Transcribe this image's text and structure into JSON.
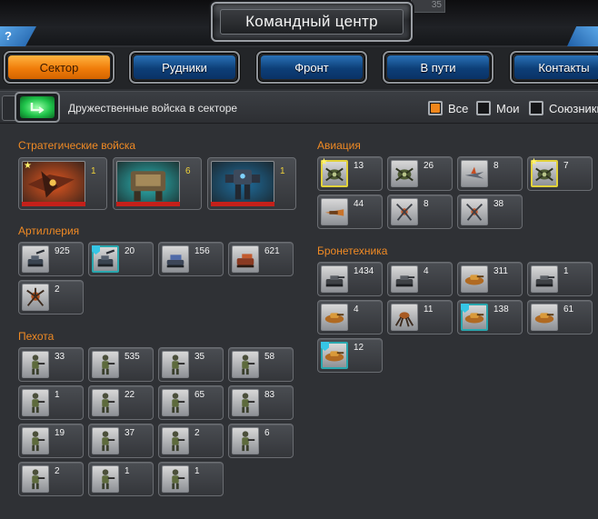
{
  "header": {
    "title": "Командный центр",
    "counter_fragment": "35",
    "help_label": "?"
  },
  "tabs": [
    {
      "label": "Сектор",
      "active": true
    },
    {
      "label": "Рудники",
      "active": false
    },
    {
      "label": "Фронт",
      "active": false
    },
    {
      "label": "В пути",
      "active": false
    },
    {
      "label": "Контакты",
      "active": false
    }
  ],
  "filter": {
    "label": "Дружественные войска в секторе",
    "options": [
      {
        "label": "Все",
        "checked": true
      },
      {
        "label": "Мои",
        "checked": false
      },
      {
        "label": "Союзники",
        "checked": false
      }
    ]
  },
  "sections": {
    "strategic": {
      "title": "Стратегические войска",
      "units": [
        {
          "count": "1",
          "icon": "strategic-bomber-icon",
          "bg": "#e2561f",
          "starred": true
        },
        {
          "count": "6",
          "icon": "armored-walker-icon",
          "bg": "#2bb8b8",
          "starred": false
        },
        {
          "count": "1",
          "icon": "heavy-mech-icon",
          "bg": "#1f6fa0",
          "starred": false
        }
      ]
    },
    "artillery": {
      "title": "Артиллерия",
      "units": [
        {
          "count": "925",
          "icon": "artillery-tank-icon",
          "frame": "normal"
        },
        {
          "count": "20",
          "icon": "artillery-tank-icon",
          "frame": "teal"
        },
        {
          "count": "156",
          "icon": "rocket-launcher-icon",
          "frame": "normal"
        },
        {
          "count": "621",
          "icon": "heavy-artillery-icon",
          "frame": "normal"
        },
        {
          "count": "2",
          "icon": "spider-artillery-icon",
          "frame": "normal"
        }
      ]
    },
    "infantry": {
      "title": "Пехота",
      "units": [
        {
          "count": "33",
          "icon": "soldier-icon",
          "frame": "normal"
        },
        {
          "count": "535",
          "icon": "soldier-icon",
          "frame": "normal"
        },
        {
          "count": "35",
          "icon": "soldier-icon",
          "frame": "normal"
        },
        {
          "count": "58",
          "icon": "soldier-icon",
          "frame": "normal"
        },
        {
          "count": "1",
          "icon": "soldier-icon",
          "frame": "normal"
        },
        {
          "count": "22",
          "icon": "soldier-icon",
          "frame": "normal"
        },
        {
          "count": "65",
          "icon": "soldier-icon",
          "frame": "normal"
        },
        {
          "count": "83",
          "icon": "soldier-icon",
          "frame": "normal"
        },
        {
          "count": "19",
          "icon": "soldier-icon",
          "frame": "normal"
        },
        {
          "count": "37",
          "icon": "soldier-icon",
          "frame": "normal"
        },
        {
          "count": "2",
          "icon": "soldier-icon",
          "frame": "normal"
        },
        {
          "count": "6",
          "icon": "soldier-icon",
          "frame": "normal"
        },
        {
          "count": "2",
          "icon": "soldier-icon",
          "frame": "normal"
        },
        {
          "count": "1",
          "icon": "soldier-icon",
          "frame": "normal"
        },
        {
          "count": "1",
          "icon": "soldier-icon",
          "frame": "normal"
        }
      ]
    },
    "aviation": {
      "title": "Авиация",
      "units": [
        {
          "count": "13",
          "icon": "gunship-icon",
          "frame": "gold"
        },
        {
          "count": "26",
          "icon": "gunship-icon",
          "frame": "normal"
        },
        {
          "count": "8",
          "icon": "fighter-jet-icon",
          "frame": "normal"
        },
        {
          "count": "7",
          "icon": "gunship-icon",
          "frame": "gold"
        },
        {
          "count": "44",
          "icon": "bomber-icon",
          "frame": "normal"
        },
        {
          "count": "8",
          "icon": "drone-icon",
          "frame": "normal"
        },
        {
          "count": "38",
          "icon": "drone-icon",
          "frame": "normal"
        }
      ]
    },
    "armor": {
      "title": "Бронетехника",
      "units": [
        {
          "count": "1434",
          "icon": "tank-icon",
          "frame": "normal"
        },
        {
          "count": "4",
          "icon": "tank-icon",
          "frame": "normal"
        },
        {
          "count": "311",
          "icon": "hover-tank-icon",
          "frame": "normal"
        },
        {
          "count": "1",
          "icon": "tank-icon",
          "frame": "normal"
        },
        {
          "count": "4",
          "icon": "hover-tank-icon",
          "frame": "normal"
        },
        {
          "count": "11",
          "icon": "spider-tank-icon",
          "frame": "normal"
        },
        {
          "count": "138",
          "icon": "hover-tank-icon",
          "frame": "teal"
        },
        {
          "count": "61",
          "icon": "hover-tank-icon",
          "frame": "normal"
        },
        {
          "count": "12",
          "icon": "hover-tank-icon",
          "frame": "teal"
        }
      ]
    }
  },
  "colors": {
    "accent_orange": "#f08a24",
    "tab_blue": "#0d3f78",
    "tab_active": "#f07d0a",
    "teal_frame": "#2aa7ae",
    "gold_frame": "#e2d23a"
  }
}
